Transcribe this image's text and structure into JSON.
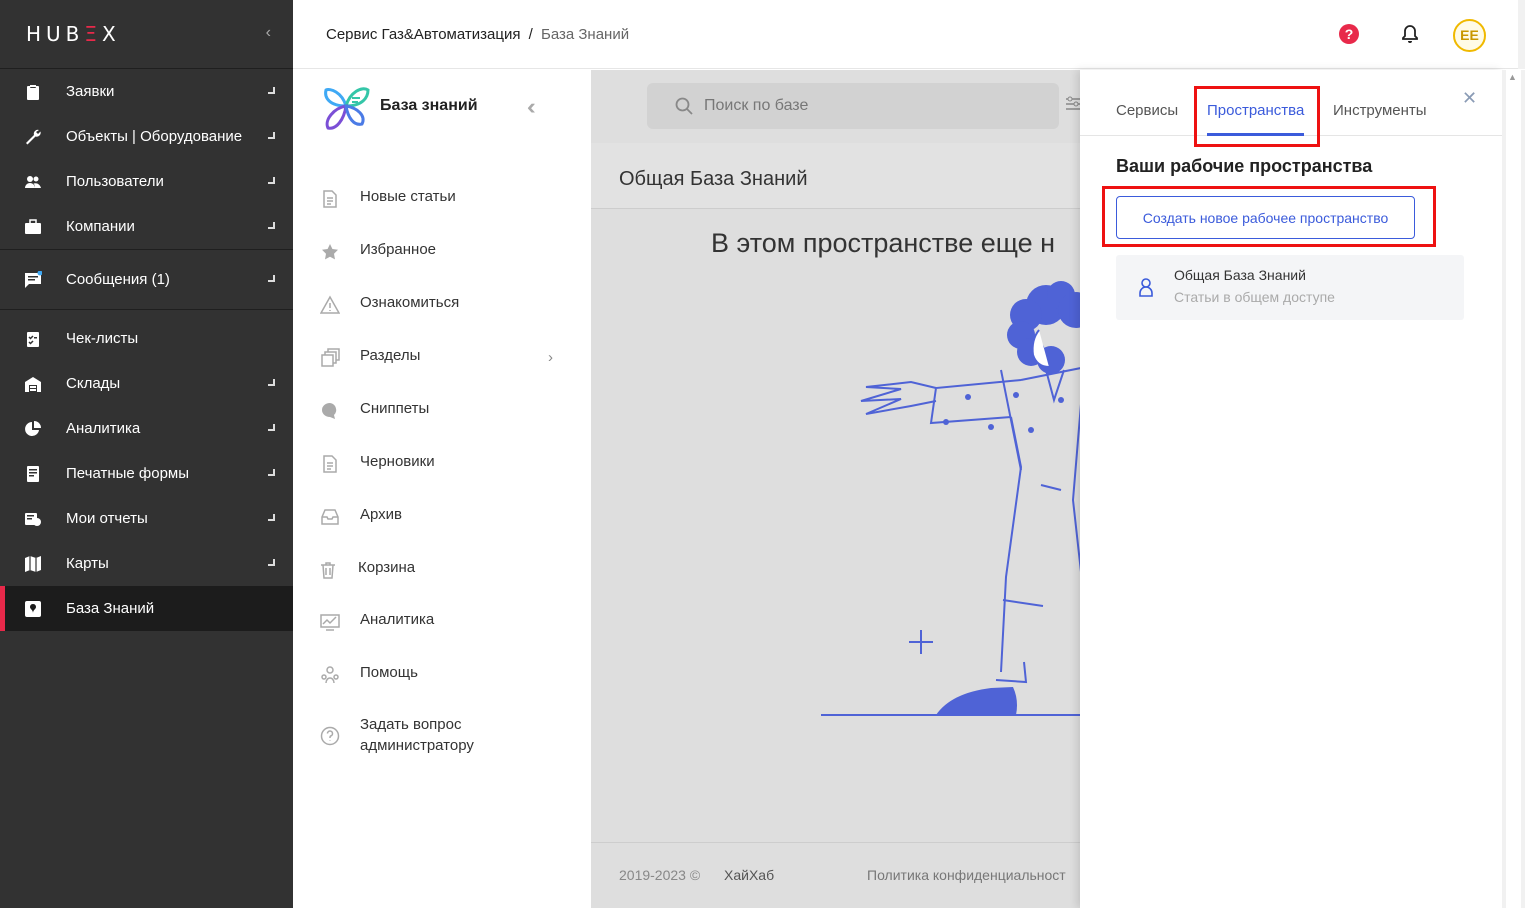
{
  "app": {
    "logo_main": "HUB",
    "logo_accent": "Ξ",
    "logo_end": "X"
  },
  "sidebar": {
    "items": [
      {
        "label": "Заявки",
        "icon": "clipboard-icon"
      },
      {
        "label": "Объекты | Оборудование",
        "icon": "wrench-icon"
      },
      {
        "label": "Пользователи",
        "icon": "users-icon"
      },
      {
        "label": "Компании",
        "icon": "briefcase-icon"
      },
      {
        "label": "Сообщения (1)",
        "icon": "message-icon"
      },
      {
        "label": "Чек-листы",
        "icon": "checklist-icon"
      },
      {
        "label": "Склады",
        "icon": "warehouse-icon"
      },
      {
        "label": "Аналитика",
        "icon": "pie-chart-icon"
      },
      {
        "label": "Печатные формы",
        "icon": "print-form-icon"
      },
      {
        "label": "Мои отчеты",
        "icon": "reports-icon"
      },
      {
        "label": "Карты",
        "icon": "map-icon"
      },
      {
        "label": "База Знаний",
        "icon": "knowledge-icon"
      }
    ]
  },
  "header": {
    "breadcrumb_service": "Сервис Газ&Автоматизация",
    "breadcrumb_sep": "/",
    "breadcrumb_page": "База Знаний",
    "avatar_initials": "EE"
  },
  "kb": {
    "title": "База знаний",
    "items": [
      {
        "label": "Новые статьи"
      },
      {
        "label": "Избранное"
      },
      {
        "label": "Ознакомиться"
      },
      {
        "label": "Разделы"
      },
      {
        "label": "Сниппеты"
      },
      {
        "label": "Черновики"
      },
      {
        "label": "Архив"
      },
      {
        "label": "Корзина"
      },
      {
        "label": "Аналитика"
      },
      {
        "label": "Помощь"
      },
      {
        "label": "Задать вопрос администратору"
      }
    ]
  },
  "main": {
    "search_placeholder": "Поиск по базе",
    "section_title": "Общая База Знаний",
    "empty_message": "В этом пространстве еще н",
    "copyright": "2019-2023 ©",
    "company": "ХайХаб",
    "privacy": "Политика конфиденциальност"
  },
  "panel": {
    "tabs": [
      "Сервисы",
      "Пространства",
      "Инструменты"
    ],
    "active_tab": "Пространства",
    "heading": "Ваши рабочие пространства",
    "create_button": "Создать новое рабочее пространство",
    "space_name": "Общая База Знаний",
    "space_desc": "Статьи в общем доступе"
  },
  "colors": {
    "sidebar_bg": "#323232",
    "accent_red": "#e8294a",
    "accent_blue": "#3b5bdb",
    "highlight_red": "#ee1111"
  }
}
